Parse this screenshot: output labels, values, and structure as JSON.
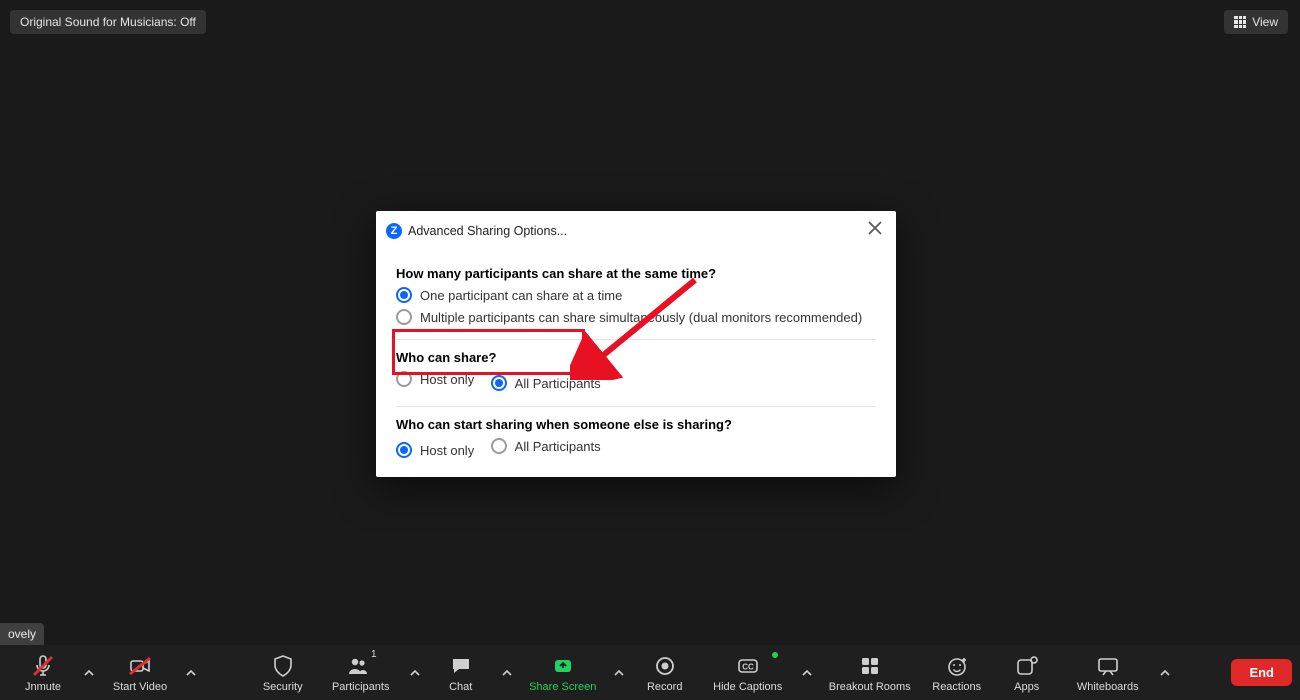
{
  "top": {
    "original_sound": "Original Sound for Musicians: Off",
    "view": "View"
  },
  "nametag": "ovely",
  "dialog": {
    "title": "Advanced Sharing Options...",
    "q1": "How many participants can share at the same time?",
    "q1_opt1": "One participant can share at a time",
    "q1_opt2": "Multiple participants can share simultaneously (dual monitors recommended)",
    "q1_selected": 0,
    "q2": "Who can share?",
    "q2_opt1": "Host only",
    "q2_opt2": "All Participants",
    "q2_selected": 1,
    "q3": "Who can start sharing when someone else is sharing?",
    "q3_opt1": "Host only",
    "q3_opt2": "All Participants",
    "q3_selected": 0
  },
  "toolbar": {
    "unmute": "Jnmute",
    "start_video": "Start Video",
    "security": "Security",
    "participants": "Participants",
    "participants_count": "1",
    "chat": "Chat",
    "share_screen": "Share Screen",
    "record": "Record",
    "hide_captions": "Hide Captions",
    "breakout": "Breakout Rooms",
    "reactions": "Reactions",
    "apps": "Apps",
    "whiteboards": "Whiteboards",
    "end": "End"
  },
  "colors": {
    "accent": "#0b66ff",
    "danger": "#e02828",
    "share": "#23d160",
    "anno": "#e81123"
  }
}
